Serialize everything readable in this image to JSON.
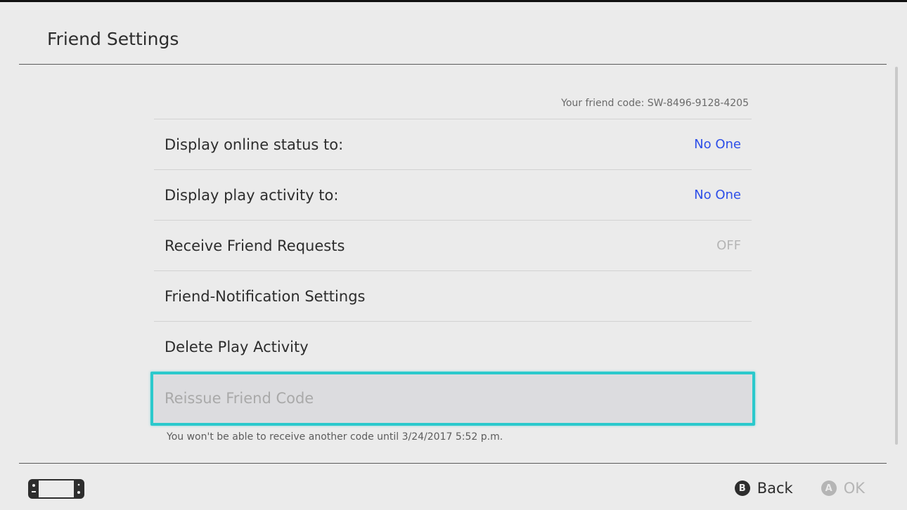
{
  "header": {
    "title": "Friend Settings"
  },
  "friend_code": {
    "text": "Your friend code: SW-8496-9128-4205"
  },
  "settings": [
    {
      "label": "Display online status to:",
      "value": "No One"
    },
    {
      "label": "Display play activity to:",
      "value": "No One"
    },
    {
      "label": "Receive Friend Requests",
      "value": "OFF"
    },
    {
      "label": "Friend-Notification Settings",
      "value": ""
    },
    {
      "label": "Delete Play Activity",
      "value": ""
    },
    {
      "label": "Reissue Friend Code",
      "value": ""
    }
  ],
  "reissue_note": "You won't be able to receive another code until 3/24/2017 5:52 p.m.",
  "footer": {
    "back": {
      "glyph": "B",
      "label": "Back"
    },
    "ok": {
      "glyph": "A",
      "label": "OK"
    }
  },
  "icons": {
    "console": "handheld-console-icon"
  },
  "colors": {
    "accent_blue": "#2d4ee8",
    "selection_cyan": "#2bc9cc",
    "background": "#ebebeb"
  }
}
